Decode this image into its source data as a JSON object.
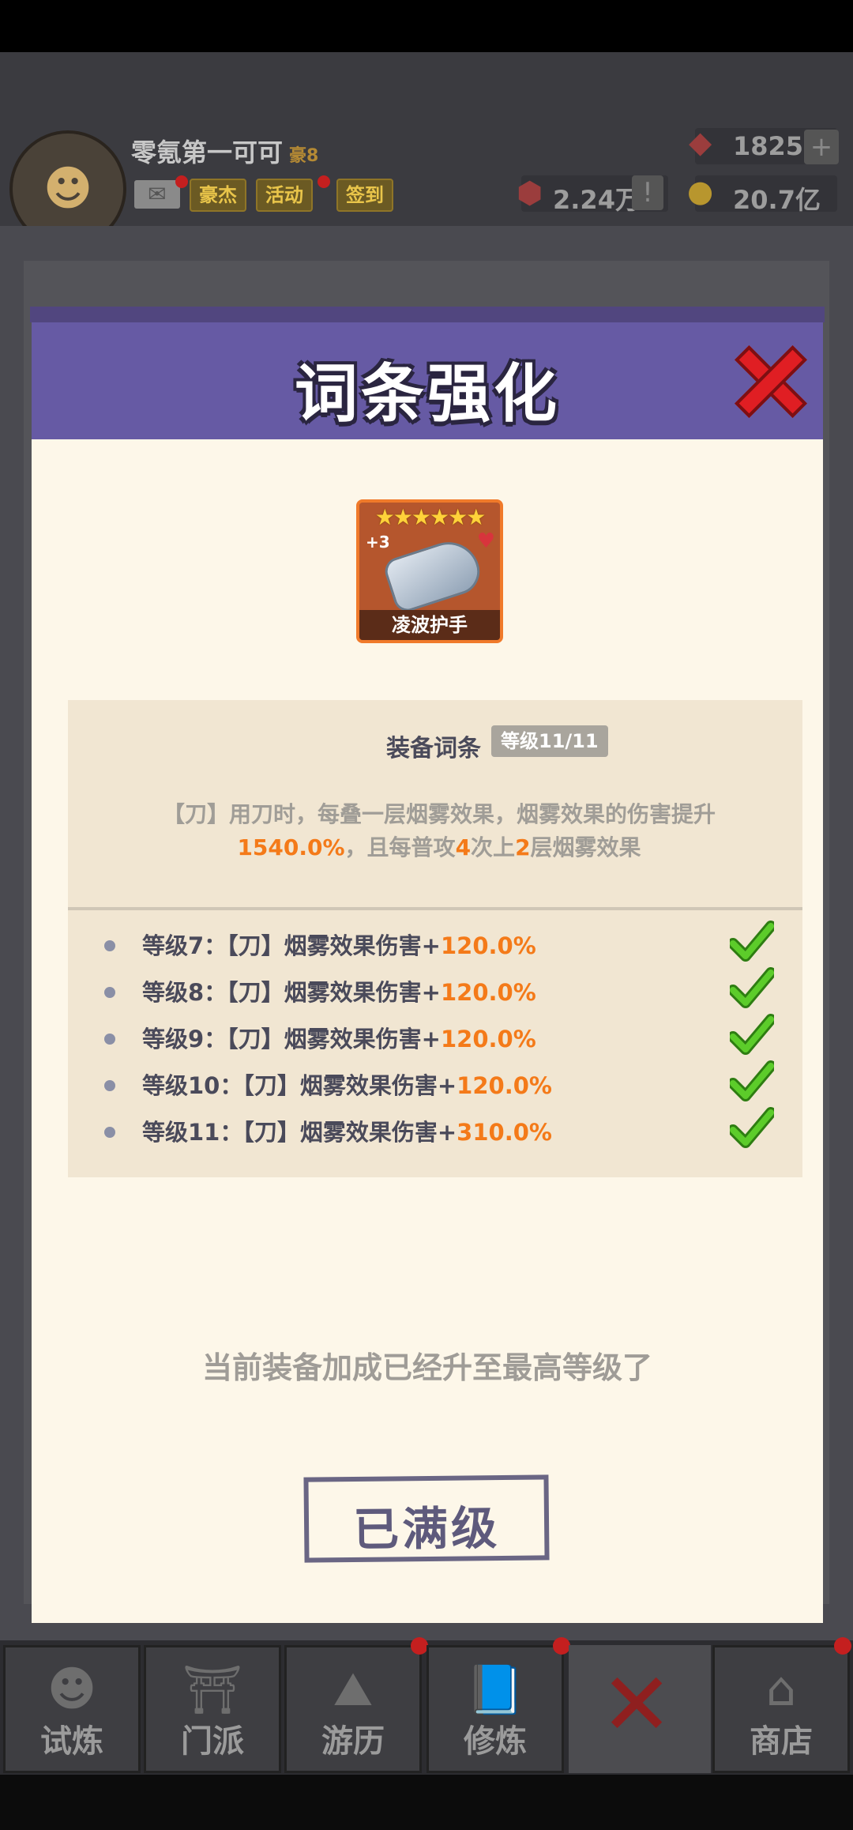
{
  "player": {
    "name": "零氪第一可可",
    "rank": "豪8",
    "chips": [
      "豪杰",
      "活动",
      "签到"
    ]
  },
  "resources": {
    "gems": "1825",
    "power": "2.24万",
    "gold": "20.7亿"
  },
  "modal": {
    "title": "词条强化",
    "item": {
      "name": "凌波护手",
      "stars": "★★★★★★",
      "plus": "+3"
    },
    "affix": {
      "title": "装备词条",
      "level": "等级11/11",
      "desc_parts": [
        "【刀】用刀时，每叠一层烟雾效果，烟雾效果的伤害提升",
        "1540.0%",
        "，且每普攻",
        "4",
        "次上",
        "2",
        "层烟雾效果"
      ]
    },
    "levels": [
      {
        "label": "等级7：【刀】烟雾效果伤害+",
        "value": "120.0%"
      },
      {
        "label": "等级8：【刀】烟雾效果伤害+",
        "value": "120.0%"
      },
      {
        "label": "等级9：【刀】烟雾效果伤害+",
        "value": "120.0%"
      },
      {
        "label": "等级10：【刀】烟雾效果伤害+",
        "value": "120.0%"
      },
      {
        "label": "等级11：【刀】烟雾效果伤害+",
        "value": "310.0%"
      }
    ],
    "max_text": "当前装备加成已经升至最高等级了",
    "max_button": "已满级"
  },
  "bottom_nav": [
    "试炼",
    "门派",
    "游历",
    "修炼",
    "商店"
  ],
  "colors": {
    "header": "#665aa4",
    "highlight": "#f47a19",
    "check": "#44b81e",
    "close": "#e01e23"
  }
}
